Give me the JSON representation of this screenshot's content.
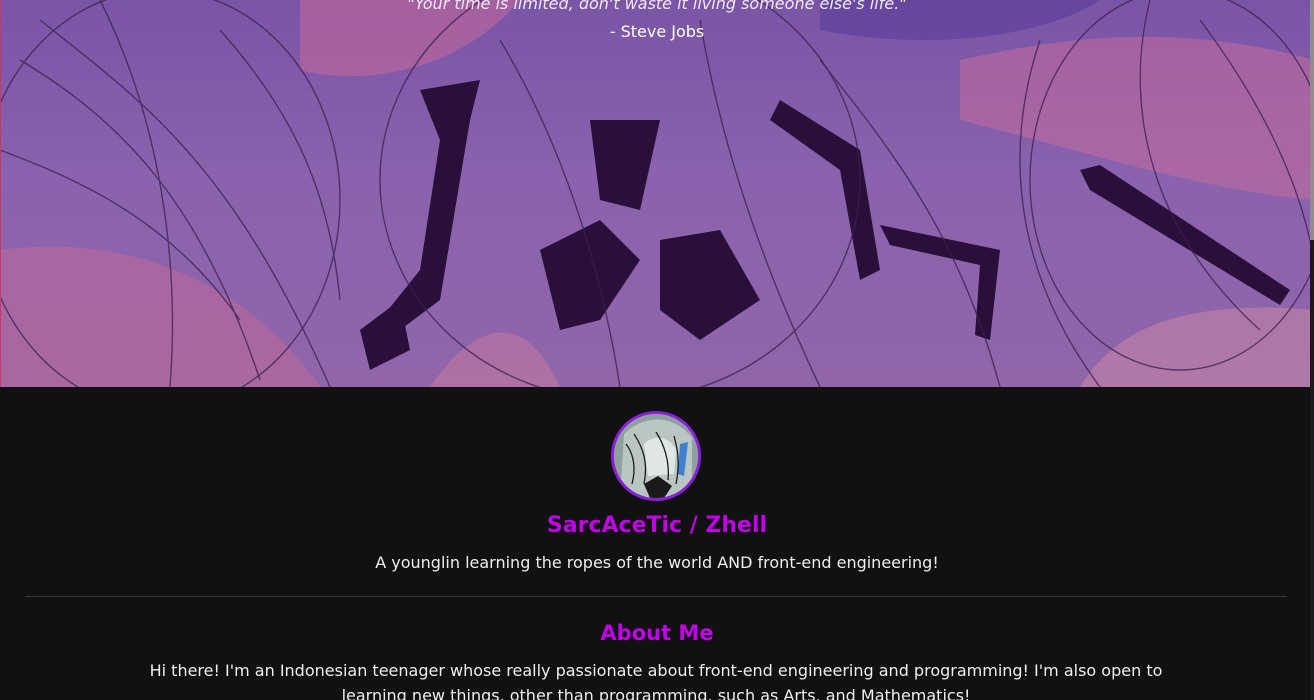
{
  "hero": {
    "quote": "\"Your time is limited, don't waste it living someone else's life.\"",
    "author": "- Steve Jobs"
  },
  "profile": {
    "name": "SarcAceTic / Zhell",
    "tagline": "A younglin learning the ropes of the world AND front-end engineering!"
  },
  "about": {
    "heading": "About Me",
    "text": "Hi there! I'm an Indonesian teenager whose really passionate about front-end engineering and programming! I'm also open to learning new things, other than programming, such as Arts, and Mathematics!"
  },
  "colors": {
    "accent": "#c000e6",
    "background": "#111111",
    "hero_purple": "#8a62ad"
  }
}
